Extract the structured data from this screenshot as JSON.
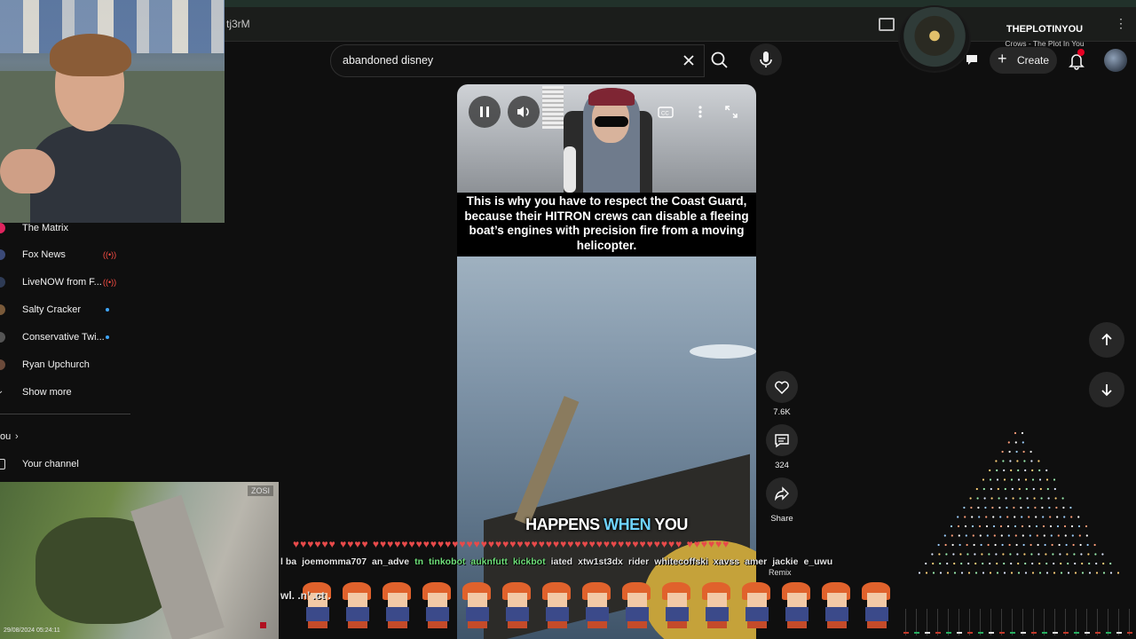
{
  "browser": {
    "url_fragment": "tj3rM"
  },
  "search": {
    "query": "abandoned disney"
  },
  "header": {
    "create_label": "Create"
  },
  "now_playing": {
    "artist": "THEPLOTINYOU",
    "track": "Crows - The Plot In You"
  },
  "sidebar": {
    "items": [
      {
        "label": "The Matrix",
        "avatar_color": "#e0245e",
        "indicator": "none"
      },
      {
        "label": "Fox News",
        "avatar_color": "#3b4a78",
        "indicator": "live"
      },
      {
        "label": "LiveNOW from F...",
        "avatar_color": "#2e3b55",
        "indicator": "live"
      },
      {
        "label": "Salty Cracker",
        "avatar_color": "#7a5a3a",
        "indicator": "dot"
      },
      {
        "label": "Conservative Twi...",
        "avatar_color": "#555555",
        "indicator": "dot"
      },
      {
        "label": "Ryan Upchurch",
        "avatar_color": "#6b4a3a",
        "indicator": "none"
      }
    ],
    "show_more": "Show more",
    "you_section": "ou",
    "your_channel": "Your channel"
  },
  "video": {
    "caption": "This is why you have to respect the Coast Guard, because their HITRON crews can disable a fleeing boat’s engines with precision fire from a moving helicopter.",
    "subtitle_before": "HAPPENS ",
    "subtitle_highlight": "WHEN",
    "subtitle_after": " YOU"
  },
  "actions": {
    "likes": "7.6K",
    "comments": "324",
    "share": "Share",
    "remix": "Remix"
  },
  "garden_cam": {
    "logo": "ZOSI",
    "timestamp": "29/08/2024 05:24:11"
  },
  "chat_overlay": {
    "usernames": [
      "l ba",
      "joemomma707",
      "an_adve",
      "tn",
      "tinkobot",
      "auknfutt",
      "kickbot",
      "iated",
      "xtw1st3dx",
      "rider",
      "whitecoffski",
      "xavss",
      "amer",
      "jackie",
      "e_uwu"
    ],
    "green_users": [
      "tn",
      "tinkobot",
      "auknfutt",
      "kickbot"
    ],
    "message": "wl. .n’ .ct ."
  }
}
